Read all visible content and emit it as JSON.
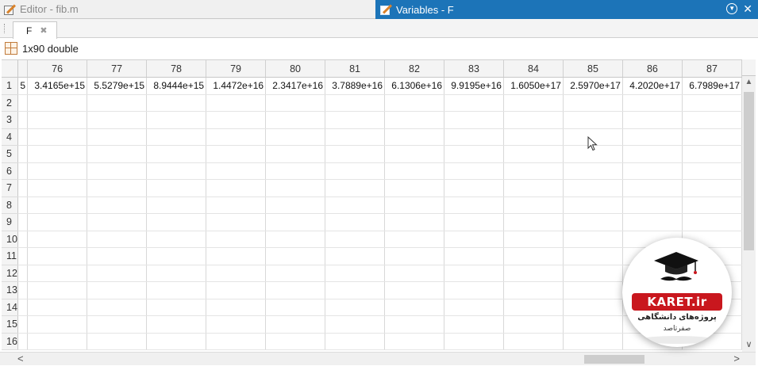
{
  "titlebar": {
    "editor_title": "Editor - fib.m",
    "variables_title": "Variables - F"
  },
  "tabs": [
    {
      "label": "F",
      "close": "✖"
    }
  ],
  "info": {
    "variable_size": "1x90 double"
  },
  "grid": {
    "columns": [
      "76",
      "77",
      "78",
      "79",
      "80",
      "81",
      "82",
      "83",
      "84",
      "85",
      "86",
      "87"
    ],
    "partial_left_value": "5",
    "row1": [
      "3.4165e+15",
      "5.5279e+15",
      "8.9444e+15",
      "1.4472e+16",
      "2.3417e+16",
      "3.7889e+16",
      "6.1306e+16",
      "9.9195e+16",
      "1.6050e+17",
      "2.5970e+17",
      "4.2020e+17",
      "6.7989e+17"
    ],
    "rows": [
      "1",
      "2",
      "3",
      "4",
      "5",
      "6",
      "7",
      "8",
      "9",
      "10",
      "11",
      "12",
      "13",
      "14",
      "15",
      "16"
    ]
  },
  "scroll": {
    "left": "<",
    "right": ">",
    "up": "▲",
    "down": "∨"
  },
  "watermark": {
    "brand": "KARET.ir",
    "line1": "پروژه‌های دانشگاهی",
    "line2": "صفرتاصد"
  },
  "colors": {
    "accent": "#1c74b8",
    "brand_red": "#c9171e"
  },
  "icons": [
    "editor-icon",
    "variables-icon",
    "grid-icon",
    "undock-icon",
    "close-icon"
  ]
}
